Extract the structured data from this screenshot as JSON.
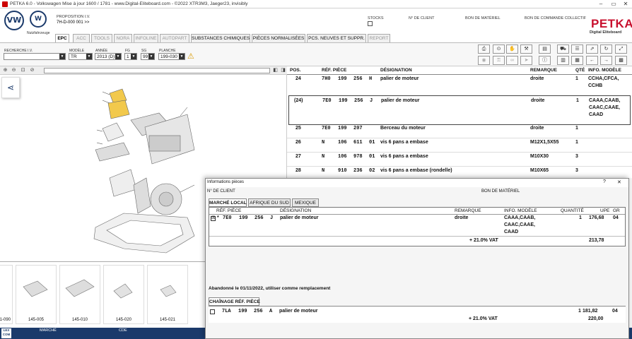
{
  "window": {
    "title": "PETKA 6.0 - Volkswagen Mise à jour 1600 / 1781 - www.Digital-Eliteboard.com - ©2022 XTR3M3, Jaeger23, invisibly"
  },
  "header": {
    "brand_logo": "VW",
    "brand_name": "Nutzfahrzeuge",
    "proposition_label": "PROPOSITION I.V.",
    "proposition_value": "7H-D-000 001 >>",
    "stocks_label": "STOCKS",
    "client_label": "N° DE CLIENT",
    "materiel_label": "BON DE MATÉRIEL",
    "commande_label": "BON DE COMMANDE COLLECTIF",
    "petka_logo": "PETKA",
    "petka_sub": "Digital Eliteboard"
  },
  "tabs": [
    {
      "label": "EPC",
      "state": "active"
    },
    {
      "label": "ACC",
      "state": "disabled"
    },
    {
      "label": "TOOLS",
      "state": "disabled"
    },
    {
      "label": "NORA",
      "state": "disabled"
    },
    {
      "label": "INFOLINE",
      "state": "disabled"
    },
    {
      "label": "AUTOPART",
      "state": "disabled"
    },
    {
      "label": "SUBSTANCES CHIMIQUES",
      "state": "enabled"
    },
    {
      "label": "PIÈCES NORMALISÉES",
      "state": "enabled"
    },
    {
      "label": "PCS. NEUVES ET SUPPR.",
      "state": "enabled"
    },
    {
      "label": "REPORT",
      "state": "disabled"
    }
  ],
  "filters": {
    "recherche_label": "RECHERCHE I.V.",
    "modele_label": "MODÈLE",
    "modele_value": "TR",
    "annee_label": "ANNÉE",
    "annee_value": "2013 (D)",
    "fg_label": "FG",
    "fg_value": "1",
    "sg_label": "SG",
    "sg_value": "99",
    "planche_label": "PLANCHE",
    "planche_value": "199-030"
  },
  "parts_table": {
    "headers": {
      "pos": "POS.",
      "ref": "RÉF. PIÈCE",
      "designation": "DÉSIGNATION",
      "remarque": "REMARQUE",
      "qte": "QTÉ",
      "info": "INFO. MODÈLE"
    },
    "rows": [
      {
        "pos": "24",
        "p1": "7H0",
        "p2": "199",
        "p3": "256",
        "p4": "H",
        "designation": "palier de moteur",
        "remarque": "droite",
        "qte": "1",
        "info1": "CCHA,CFCA,",
        "info2": "CCHB",
        "info3": "",
        "info4": ""
      },
      {
        "pos": "(24)",
        "p1": "7E0",
        "p2": "199",
        "p3": "256",
        "p4": "J",
        "designation": "palier de moteur",
        "remarque": "droite",
        "qte": "1",
        "info1": "CAAA,CAAB,",
        "info2": "CAAC,CAAE,",
        "info3": "CAAD",
        "info4": ""
      },
      {
        "pos": "25",
        "p1": "7E0",
        "p2": "199",
        "p3": "207",
        "p4": "",
        "designation": "Berceau du moteur",
        "remarque": "droite",
        "qte": "1",
        "info1": "",
        "info2": "",
        "info3": "",
        "info4": ""
      },
      {
        "pos": "26",
        "p1": "N",
        "p2": "106",
        "p3": "611",
        "p4": "01",
        "designation": "vis 6 pans a embase",
        "remarque": "M12X1,5X55",
        "qte": "1",
        "info1": "",
        "info2": "",
        "info3": "",
        "info4": ""
      },
      {
        "pos": "27",
        "p1": "N",
        "p2": "106",
        "p3": "978",
        "p4": "01",
        "designation": "vis 6 pans a embase",
        "remarque": "M10X30",
        "qte": "3",
        "info1": "",
        "info2": "",
        "info3": "",
        "info4": ""
      },
      {
        "pos": "28",
        "p1": "N",
        "p2": "910",
        "p3": "236",
        "p4": "02",
        "designation": "vis 6 pans a embase (rondelle)",
        "remarque": "M10X65",
        "qte": "3",
        "info1": "",
        "info2": "",
        "info3": "",
        "info4": ""
      }
    ]
  },
  "thumbnails": [
    {
      "caption": "1-090"
    },
    {
      "caption": "145-005"
    },
    {
      "caption": "145-010"
    },
    {
      "caption": "145-020"
    },
    {
      "caption": "145-021"
    }
  ],
  "footer": {
    "badge": "LEX COM",
    "marche_label": "MARCHÉ",
    "code_label": "CDE"
  },
  "dialog": {
    "title": "Informations pièces",
    "help": "?",
    "close": "✕",
    "client_label": "N° DE CLIENT",
    "materiel_label": "BON DE MATÉRIEL",
    "tabs": [
      "MARCHÉ LOCAL",
      "AFRIQUE DU SUD",
      "MEXIQUE"
    ],
    "headers": {
      "ref": "RÉF. PIÈCE",
      "designation": "DÉSIGNATION",
      "remarque": "REMARQUE",
      "info": "INFO. MODÈLE",
      "quantite": "QUANTITÉ",
      "upe": "UPE",
      "gr": "GR"
    },
    "row": {
      "check": "☒",
      "star": "*",
      "p1": "7E0",
      "p2": "199",
      "p3": "256",
      "p4": "J",
      "designation": "palier de moteur",
      "remarque": "droite",
      "info1": "CAAA,CAAB,",
      "info2": "CAAC,CAAE,",
      "info3": "CAAD",
      "quantite": "1",
      "upe": "176,68",
      "gr": "04",
      "tva": "+ 21.0% VAT",
      "total": "213,78"
    },
    "abandon_text": "Abandonné le 01/11/2022, utiliser comme remplacement",
    "chain_tab": "CHAÎNAGE RÉF. PIÈCE",
    "chain_row": {
      "p1": "7LA",
      "p2": "199",
      "p3": "256",
      "p4": "A",
      "designation": "palier de moteur",
      "quantite": "1",
      "upe": "181,82",
      "gr": "04",
      "tva": "+ 21.0% VAT",
      "total": "220,00"
    }
  },
  "colors": {
    "brand": "#1b3a6b",
    "petka_red": "#c8102e",
    "highlight": "#e8b100"
  }
}
